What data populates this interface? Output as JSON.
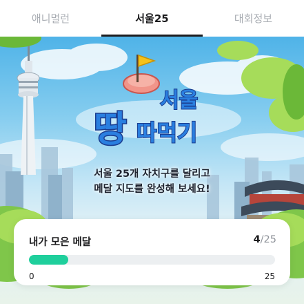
{
  "tabs": [
    {
      "label": "애니멀런",
      "active": false
    },
    {
      "label": "서울25",
      "active": true
    },
    {
      "label": "대회정보",
      "active": false
    }
  ],
  "banner": {
    "logo_small_text": "서울",
    "logo_big_char": "땅",
    "logo_sub_text": "따먹기",
    "slogan_line1": "서울 25개 자치구를 달리고",
    "slogan_line2": "메달 지도를 완성해 보세요!"
  },
  "medal_card": {
    "title": "내가 모은 메달",
    "collected": "4",
    "total_suffix": "/25",
    "progress_value": 4,
    "progress_max": 25,
    "scale_min": "0",
    "scale_max": "25",
    "progress_color": "#1fcf9c"
  },
  "colors": {
    "active_tab": "#1c1c1e",
    "inactive_tab": "#a9adb3",
    "logo_fill": "#2a7fe0",
    "logo_outline": "#1b3d8f"
  }
}
